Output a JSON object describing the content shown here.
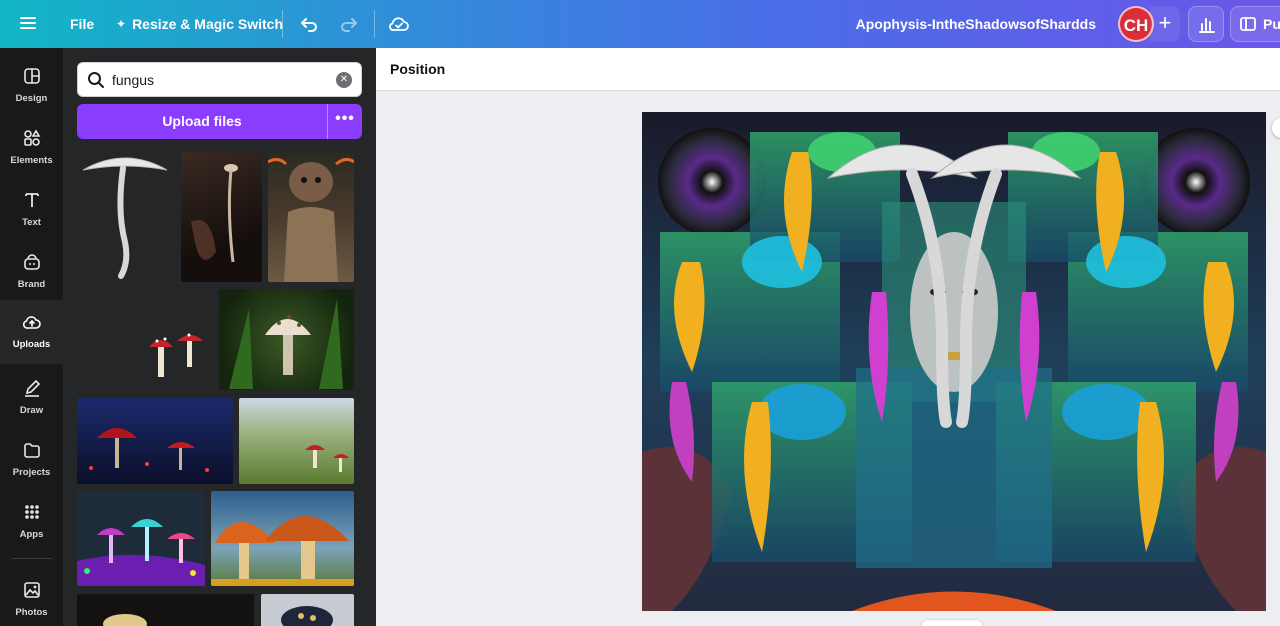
{
  "topbar": {
    "file_label": "File",
    "resize_label": "Resize & Magic Switch",
    "document_title": "Apophysis-IntheShadowsofShardds",
    "avatar_initials": "CH",
    "publish_label": "Pu"
  },
  "rail": {
    "items": [
      {
        "label": "Design",
        "icon": "design-icon"
      },
      {
        "label": "Elements",
        "icon": "elements-icon"
      },
      {
        "label": "Text",
        "icon": "text-icon"
      },
      {
        "label": "Brand",
        "icon": "brand-icon"
      },
      {
        "label": "Uploads",
        "icon": "uploads-icon",
        "active": true
      },
      {
        "label": "Draw",
        "icon": "draw-icon"
      },
      {
        "label": "Projects",
        "icon": "projects-icon"
      },
      {
        "label": "Apps",
        "icon": "apps-icon"
      },
      {
        "label": "Photos",
        "icon": "photos-icon"
      }
    ]
  },
  "panel": {
    "search_value": "fungus",
    "upload_label": "Upload files",
    "more_label": "•••"
  },
  "context_bar": {
    "position_label": "Position"
  },
  "colors": {
    "accent": "#8b3dff",
    "rail_bg": "#18191b",
    "panel_bg": "#252627",
    "avatar": "#d92d3a"
  }
}
